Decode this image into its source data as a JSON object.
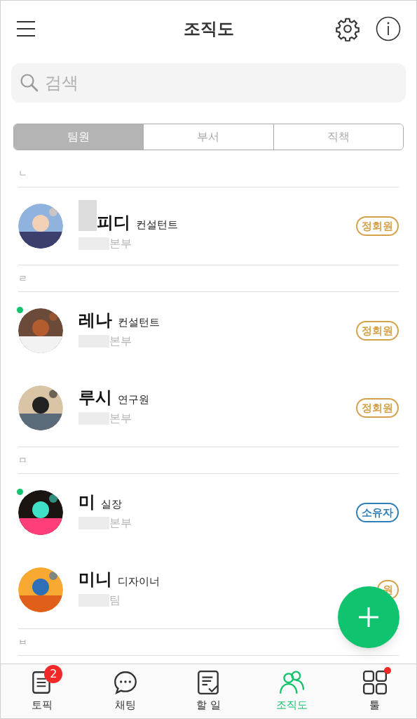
{
  "header": {
    "title": "조직도"
  },
  "search": {
    "placeholder": "검색"
  },
  "tabs": [
    {
      "label": "팀원",
      "selected": true
    },
    {
      "label": "부서",
      "selected": false
    },
    {
      "label": "직책",
      "selected": false
    }
  ],
  "sections": [
    {
      "letter": "ㄴ",
      "members": [
        {
          "name": "피디",
          "role": "컨설턴트",
          "dept": "본부",
          "online": false,
          "redacted_name": true,
          "badge": {
            "text": "정회원",
            "color": "#d4a24c"
          }
        }
      ]
    },
    {
      "letter": "ㄹ",
      "members": [
        {
          "name": "레나",
          "role": "컨설턴트",
          "dept": "본부",
          "online": true,
          "redacted_name": false,
          "badge": {
            "text": "정회원",
            "color": "#d4a24c"
          }
        },
        {
          "name": "루시",
          "role": "연구원",
          "dept": "본부",
          "online": false,
          "redacted_name": false,
          "badge": {
            "text": "정회원",
            "color": "#d4a24c"
          }
        }
      ]
    },
    {
      "letter": "ㅁ",
      "members": [
        {
          "name": "미",
          "role": "실장",
          "dept": "본부",
          "online": true,
          "redacted_name": false,
          "badge": {
            "text": "소유자",
            "color": "#2f7fb8"
          }
        },
        {
          "name": "미니",
          "role": "디자이너",
          "dept": "팀",
          "online": false,
          "redacted_name": false,
          "badge": {
            "text": "원",
            "color": "#d4a24c"
          }
        }
      ]
    },
    {
      "letter": "ㅂ"
    }
  ],
  "nav": [
    {
      "kind": "topic",
      "label": "토픽",
      "selected": false,
      "count": "2",
      "dot": false
    },
    {
      "kind": "chat",
      "label": "채팅",
      "selected": false,
      "dot": false
    },
    {
      "kind": "todo",
      "label": "할 일",
      "selected": false,
      "dot": false
    },
    {
      "kind": "org",
      "label": "조직도",
      "selected": true,
      "dot": false
    },
    {
      "kind": "tools",
      "label": "툴",
      "selected": false,
      "dot": true
    }
  ]
}
